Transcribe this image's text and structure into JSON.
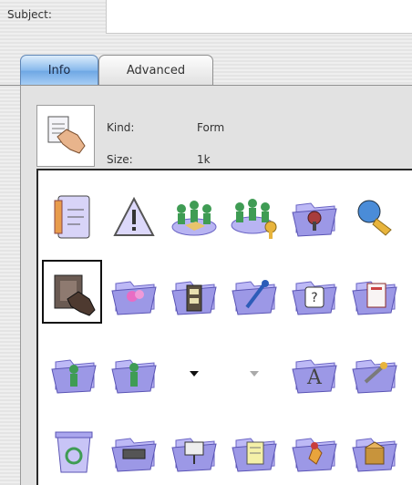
{
  "subject": {
    "label": "Subject:"
  },
  "tabs": [
    {
      "label": "Info",
      "selected": true
    },
    {
      "label": "Advanced",
      "selected": false
    }
  ],
  "info": {
    "kind_label": "Kind:",
    "kind_value": "Form",
    "size_label": "Size:",
    "size_value": "1k"
  },
  "icon_palette": {
    "selected_index": 6,
    "icons": [
      "form-document-icon",
      "warning-triangle-icon",
      "users-group-icon",
      "users-group-key-icon",
      "folder-security-icon",
      "search-user-icon",
      "form-hand-icon",
      "folder-pink-icon",
      "folder-cabinet-icon",
      "folder-pin-icon",
      "folder-help-icon",
      "folder-documents-icon",
      "folder-user-icon",
      "folder-person-icon",
      "dropdown-arrow-black-icon",
      "dropdown-arrow-gray-icon",
      "folder-font-icon",
      "folder-tools-icon",
      "trash-recycle-icon",
      "folder-drive-icon",
      "folder-network-icon",
      "folder-note-icon",
      "folder-favorites-icon",
      "folder-box-icon"
    ]
  },
  "colors": {
    "tab_selected": "#86b8ec",
    "folder_body": "#9c98e6",
    "folder_back": "#bdb9f6"
  }
}
